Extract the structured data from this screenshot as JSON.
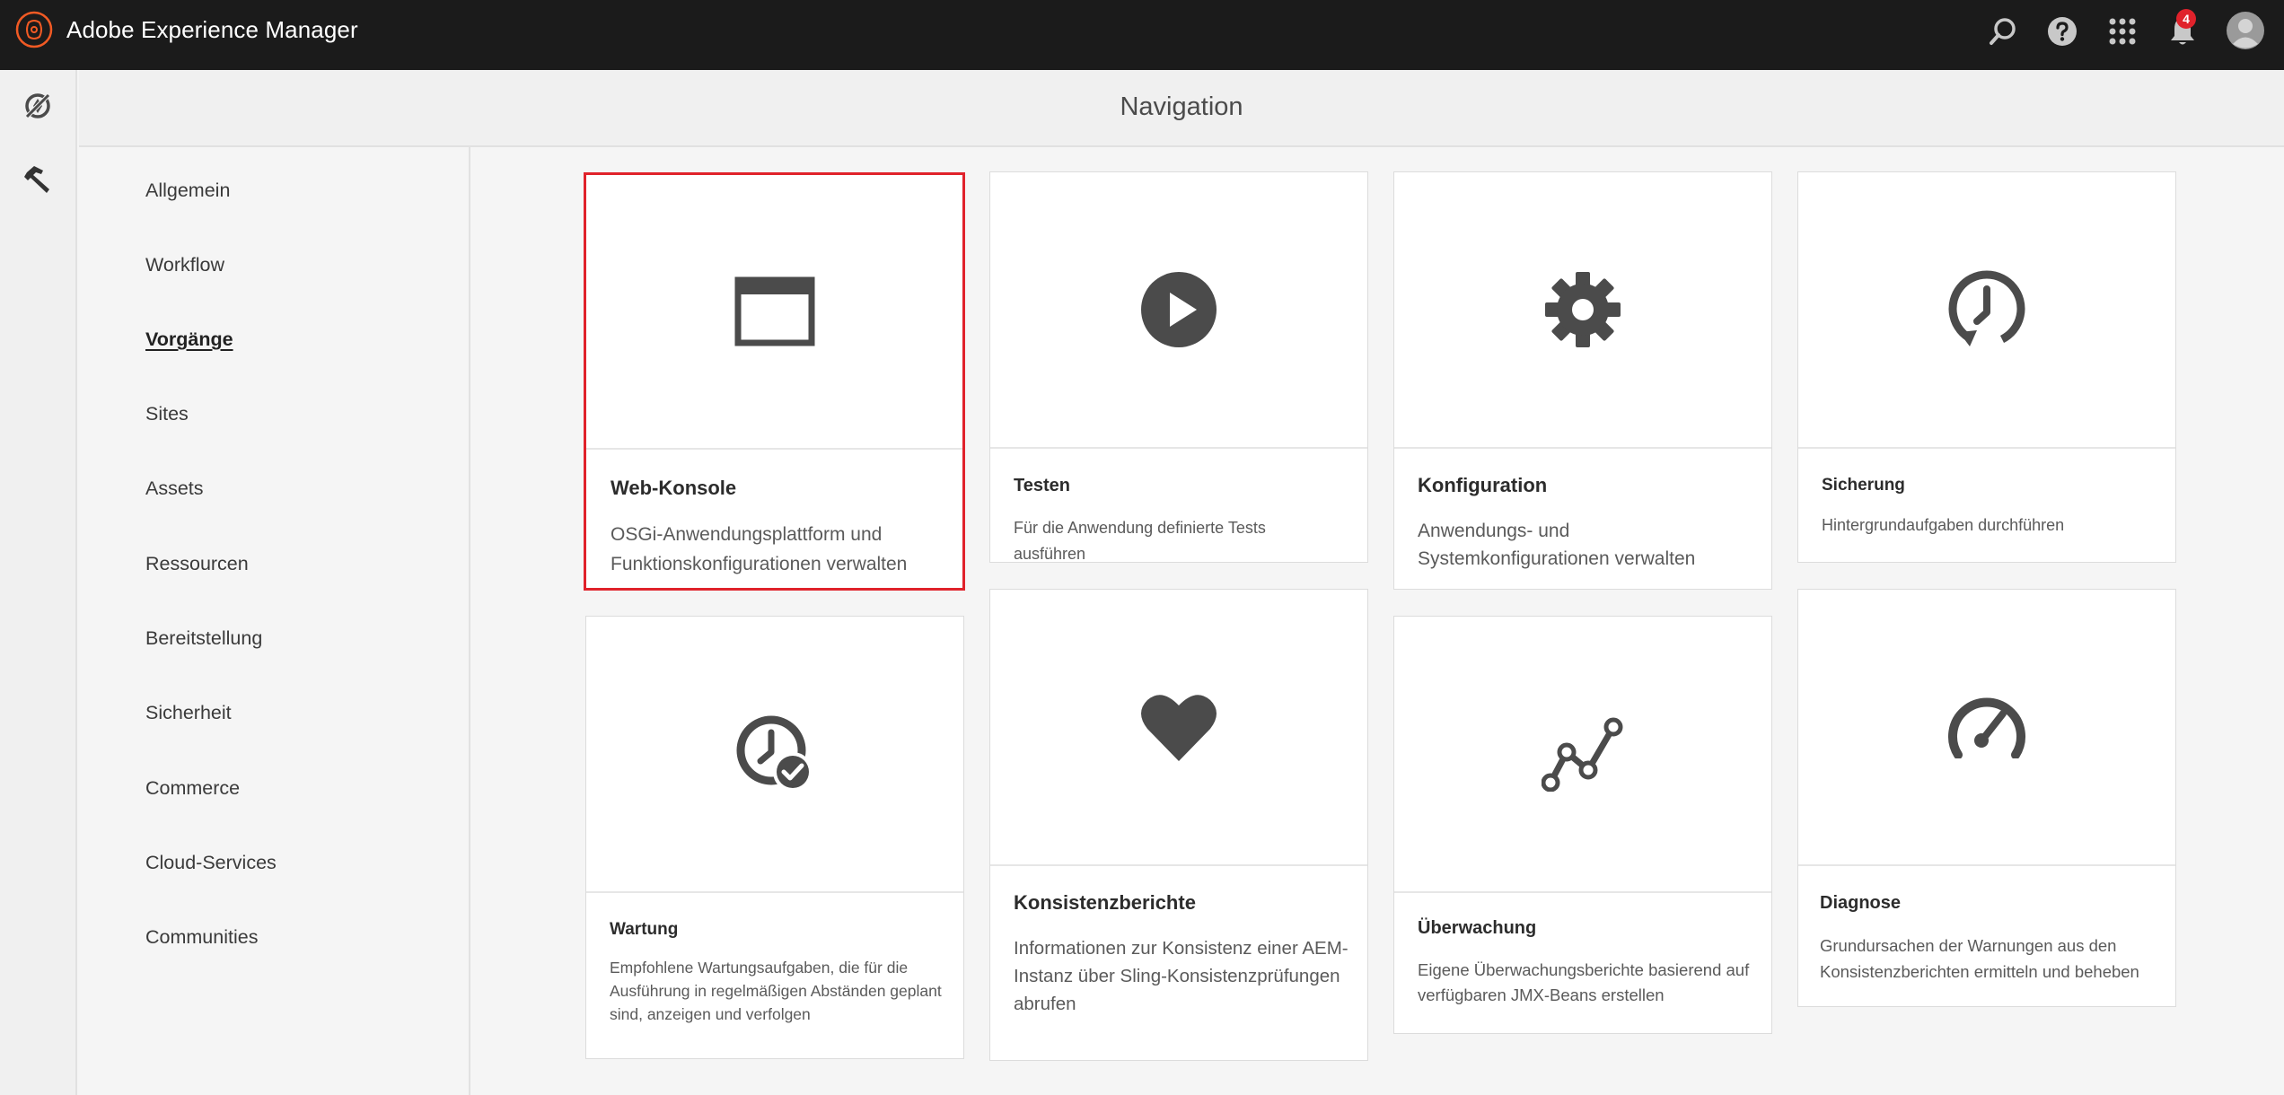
{
  "app": {
    "title": "Adobe Experience Manager"
  },
  "topbar": {
    "icons": [
      "search-icon",
      "help-icon",
      "solutions-grid-icon",
      "notifications-bell-icon",
      "user-avatar-icon"
    ],
    "notification_count": "4"
  },
  "rail": {
    "items": [
      "navigation-icon",
      "tools-hammer-icon"
    ]
  },
  "header": {
    "title": "Navigation"
  },
  "categories": [
    {
      "label": "Allgemein",
      "active": false
    },
    {
      "label": "Workflow",
      "active": false
    },
    {
      "label": "Vorgänge",
      "active": true
    },
    {
      "label": "Sites",
      "active": false
    },
    {
      "label": "Assets",
      "active": false
    },
    {
      "label": "Ressourcen",
      "active": false
    },
    {
      "label": "Bereitstellung",
      "active": false
    },
    {
      "label": "Sicherheit",
      "active": false
    },
    {
      "label": "Commerce",
      "active": false
    },
    {
      "label": "Cloud-Services",
      "active": false
    },
    {
      "label": "Communities",
      "active": false
    }
  ],
  "cards": [
    {
      "icon": "window-icon",
      "title": "Web-Konsole",
      "description": "OSGi-Anwendungsplattform und Funktionskonfigurationen verwalten",
      "selected": true
    },
    {
      "icon": "play-icon",
      "title": "Testen",
      "description": "Für die Anwendung definierte Tests ausführen",
      "selected": false
    },
    {
      "icon": "gear-icon",
      "title": "Konfiguration",
      "description": "Anwendungs- und Systemkonfigurationen verwalten",
      "selected": false
    },
    {
      "icon": "backup-clock-icon",
      "title": "Sicherung",
      "description": "Hintergrundaufgaben durchführen",
      "selected": false
    },
    {
      "icon": "maintenance-clock-check-icon",
      "title": "Wartung",
      "description": "Empfohlene Wartungsaufgaben, die für die Ausführung in regelmäßigen Abständen geplant sind, anzeigen und verfolgen",
      "selected": false
    },
    {
      "icon": "heart-icon",
      "title": "Konsistenzberichte",
      "description": "Informationen zur Konsistenz einer AEM-Instanz über Sling-Konsistenzprüfungen abrufen",
      "selected": false
    },
    {
      "icon": "line-graph-icon",
      "title": "Überwachung",
      "description": "Eigene Überwachungsberichte basierend auf verfügbaren JMX-Beans erstellen",
      "selected": false
    },
    {
      "icon": "speedometer-icon",
      "title": "Diagnose",
      "description": "Grundursachen der Warnungen aus den Konsistenzberichten ermitteln und beheben",
      "selected": false
    }
  ],
  "colors": {
    "topbar": "#1b1b1b",
    "accent_red": "#e0222b",
    "icon_gray": "#4b4b4b"
  }
}
